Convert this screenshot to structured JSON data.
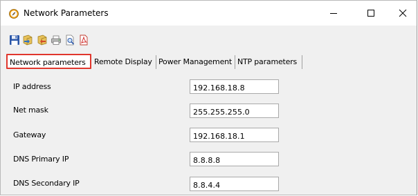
{
  "window": {
    "title": "Network Parameters",
    "icon": "compass-icon",
    "controls": [
      "minimize-icon",
      "maximize-icon",
      "close-icon"
    ]
  },
  "toolbar": {
    "buttons": [
      {
        "name": "save",
        "icon": "floppy-disk-icon"
      },
      {
        "name": "import",
        "icon": "import-icon"
      },
      {
        "name": "export",
        "icon": "export-icon"
      },
      {
        "name": "print",
        "icon": "printer-icon"
      },
      {
        "name": "preview",
        "icon": "print-preview-icon"
      },
      {
        "name": "pdf",
        "icon": "pdf-icon"
      }
    ]
  },
  "tabs": [
    {
      "label": "Network parameters",
      "active": true
    },
    {
      "label": "Remote Display",
      "active": false
    },
    {
      "label": "Power Management",
      "active": false
    },
    {
      "label": "NTP parameters",
      "active": false
    }
  ],
  "fields": [
    {
      "label": "IP address",
      "value": "192.168.18.8"
    },
    {
      "label": "Net mask",
      "value": "255.255.255.0"
    },
    {
      "label": "Gateway",
      "value": "192.168.18.1"
    },
    {
      "label": "DNS Primary IP",
      "value": "8.8.8.8"
    },
    {
      "label": "DNS Secondary IP",
      "value": "8.8.4.4"
    }
  ],
  "colors": {
    "active_tab_highlight": "#e0362c",
    "panel_background": "#f0f0f0"
  }
}
